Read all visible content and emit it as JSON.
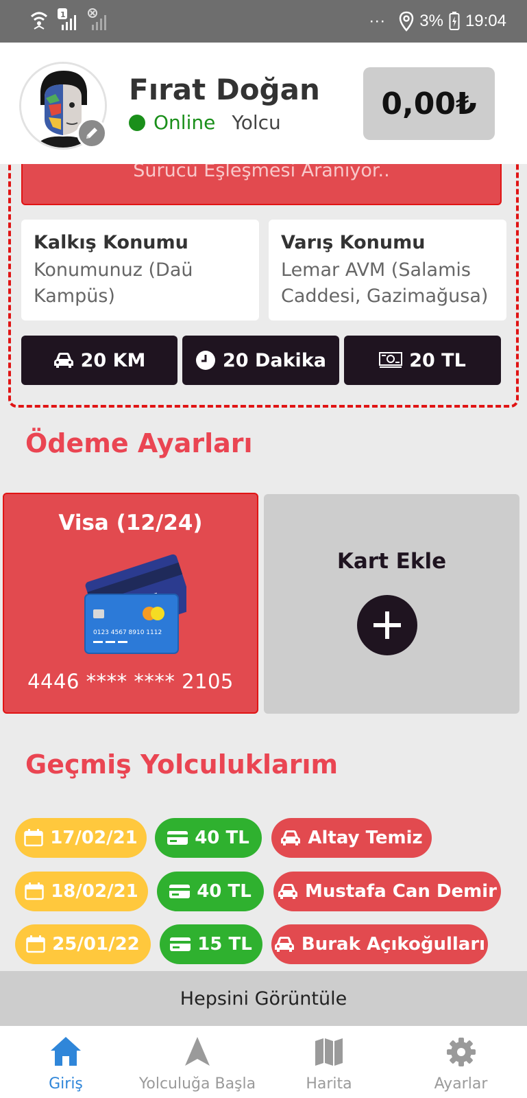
{
  "status_bar": {
    "battery": "3%",
    "time": "19:04",
    "more": "···"
  },
  "header": {
    "name": "Fırat Doğan",
    "status": "Online",
    "role": "Yolcu",
    "balance": "0,00₺"
  },
  "ride": {
    "search_status": "Sürücü Eşleşmesi Aranıyor..",
    "from": {
      "title": "Kalkış Konumu",
      "value": "Konumunuz (Daü Kampüs)"
    },
    "to": {
      "title": "Varış Konumu",
      "value": "Lemar AVM (Salamis Caddesi, Gazimağusa)"
    },
    "distance": "20 KM",
    "duration": "20 Dakika",
    "price": "20 TL"
  },
  "payment": {
    "title": "Ödeme Ayarları",
    "card": {
      "name": "Visa (12/24)",
      "number": "4446 **** **** 2105",
      "printed_number": "0123 4567 8910 1112"
    },
    "add_label": "Kart Ekle"
  },
  "history": {
    "title": "Geçmiş Yolculuklarım",
    "rows": [
      {
        "date": "17/02/21",
        "amount": "40 TL",
        "driver": "Altay Temiz"
      },
      {
        "date": "18/02/21",
        "amount": "40 TL",
        "driver": "Mustafa Can Demir"
      },
      {
        "date": "25/01/22",
        "amount": "15 TL",
        "driver": "Burak Açıkoğulları"
      }
    ],
    "view_all": "Hepsini Görüntüle"
  },
  "nav": {
    "items": [
      {
        "label": "Giriş",
        "icon": "home-icon",
        "active": true
      },
      {
        "label": "Yolculuğa Başla",
        "icon": "navigation-arrow-icon",
        "active": false
      },
      {
        "label": "Harita",
        "icon": "map-icon",
        "active": false
      },
      {
        "label": "Ayarlar",
        "icon": "gear-icon",
        "active": false
      }
    ]
  },
  "colors": {
    "accent_red": "#e24a4f",
    "dark": "#1f1420",
    "green": "#2fb12f",
    "yellow": "#ffc83d",
    "nav_active": "#2f86d9"
  }
}
